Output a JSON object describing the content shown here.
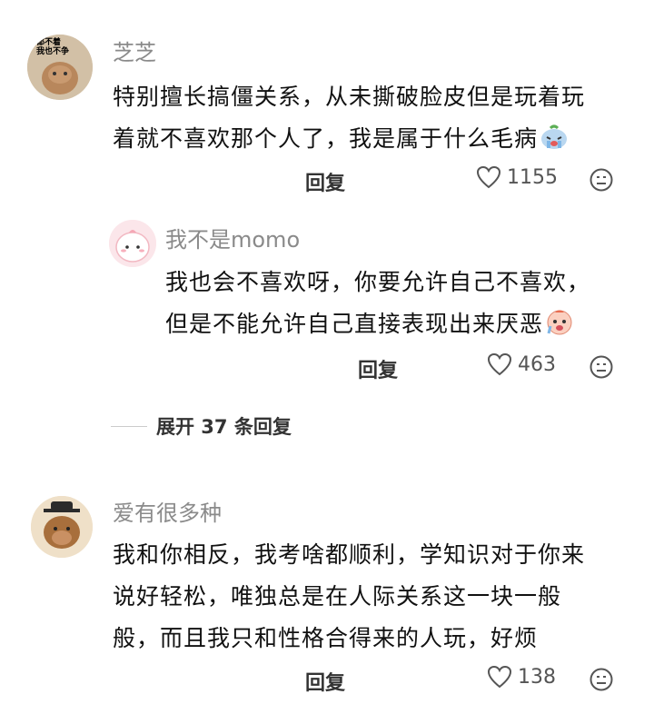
{
  "comments": [
    {
      "username": "芝芝",
      "avatar_text": "都不着\n我也不争",
      "lines": [
        "特别擅长搞僵关系，从未撕破脸皮但是玩着玩",
        "着就不喜欢那个人了，我是属于什么毛病"
      ],
      "emoji": "crying-face",
      "reply_label": "回复",
      "like_count": "1155"
    },
    {
      "username": "我不是momo",
      "lines": [
        "我也会不喜欢呀，你要允许自己不喜欢，",
        "但是不能允许自己直接表现出来厌恶"
      ],
      "emoji": "sad-face",
      "reply_label": "回复",
      "like_count": "463"
    },
    {
      "username": "爱有很多种",
      "lines": [
        "我和你相反，我考啥都顺利，学知识对于你来",
        "说好轻松，唯独总是在人际关系这一块一般",
        "般，而且我只和性格合得来的人玩，好烦"
      ],
      "reply_label": "回复",
      "like_count": "138"
    }
  ],
  "expand_replies": "展开 37 条回复",
  "icons": [
    "heart-icon",
    "emoji-icon"
  ]
}
